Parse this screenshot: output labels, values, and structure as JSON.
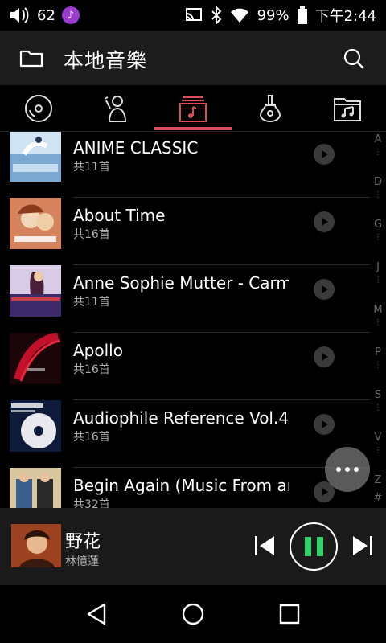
{
  "status_bar": {
    "volume_level": "62",
    "battery": "99%",
    "time": "下午2:44"
  },
  "header": {
    "title": "本地音樂"
  },
  "tabs": [
    {
      "name": "disc-tab",
      "icon": "disc-icon",
      "active": false
    },
    {
      "name": "artist-tab",
      "icon": "artist-icon",
      "active": false
    },
    {
      "name": "album-tab",
      "icon": "album-icon",
      "active": true
    },
    {
      "name": "genre-tab",
      "icon": "guitar-icon",
      "active": false
    },
    {
      "name": "folder-tab",
      "icon": "music-folder-icon",
      "active": false
    }
  ],
  "albums": [
    {
      "title": "ANIME CLASSIC",
      "count": "共11首"
    },
    {
      "title": "About Time",
      "count": "共16首"
    },
    {
      "title": "Anne Sophie Mutter - Carmen",
      "count": "共11首"
    },
    {
      "title": "Apollo",
      "count": "共16首"
    },
    {
      "title": "Audiophile Reference Vol.4",
      "count": "共16首"
    },
    {
      "title": "Begin Again (Music From and Inspired By the Original Motion Picture)",
      "count": "共32首"
    }
  ],
  "alphabet_index": [
    "A",
    "D",
    "G",
    "J",
    "M",
    "P",
    "S",
    "V",
    "Z",
    "#"
  ],
  "now_playing": {
    "title": "野花",
    "artist": "林憶蓮"
  },
  "colors": {
    "accent": "#e04b5b",
    "play_green": "#2fd46b",
    "header_bg": "#1c1c1c"
  }
}
